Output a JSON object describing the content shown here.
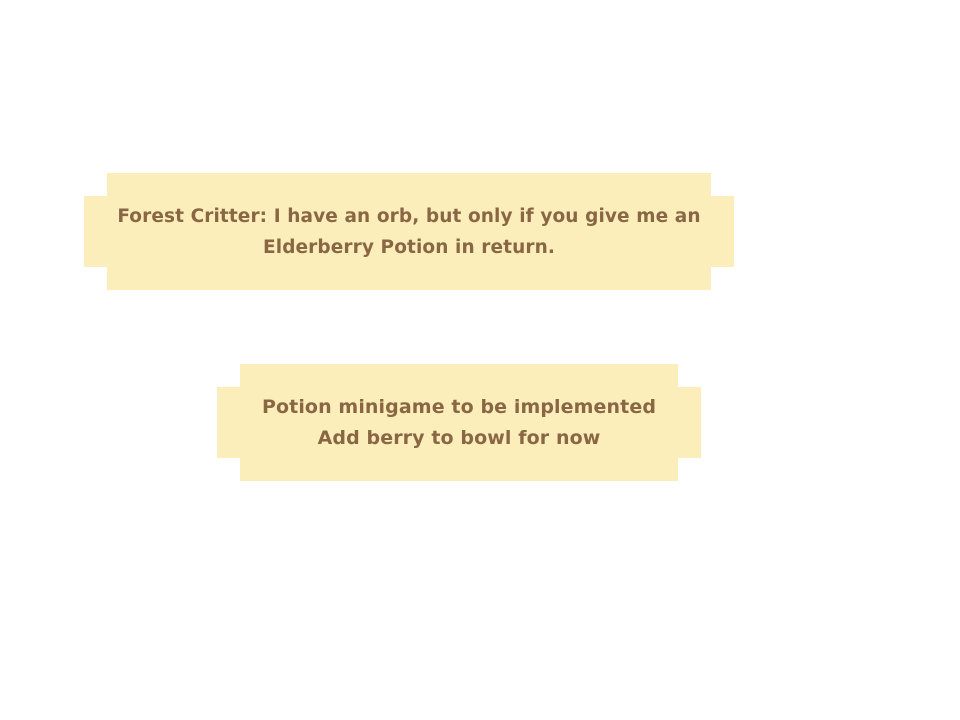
{
  "dialogue": {
    "line1": "Forest Critter: I have an orb, but only if you give me an",
    "line2": "Elderberry Potion in return."
  },
  "notice": {
    "line1": "Potion minigame to be implemented",
    "line2": "Add berry to bowl for now"
  },
  "colors": {
    "panel_background": "#fbeebb",
    "text": "#8a6744",
    "page_background": "#ffffff"
  }
}
